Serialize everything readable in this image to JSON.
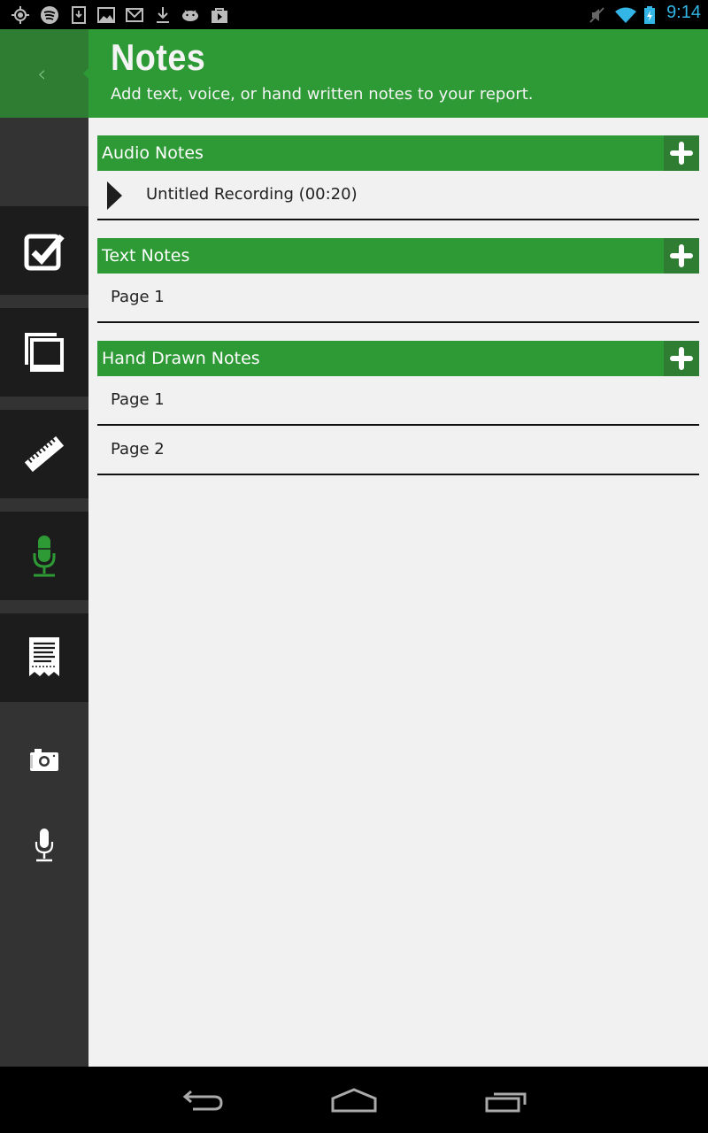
{
  "status_bar": {
    "left_icons": [
      "gps-icon",
      "spotify-icon",
      "sd-download-icon",
      "gallery-icon",
      "gmail-icon",
      "download-icon",
      "android-icon",
      "play-store-icon"
    ],
    "right_icons": [
      "mute-icon",
      "wifi-icon",
      "battery-charging-icon"
    ],
    "time": "9:14",
    "time_color": "#33b5e5"
  },
  "header": {
    "title": "Notes",
    "subtitle": "Add text, voice, or hand written notes to your report."
  },
  "sidebar": {
    "back_icon": "back-chevron-icon",
    "items": [
      {
        "name": "checklist",
        "icon": "checkbox-icon",
        "active": false
      },
      {
        "name": "photos",
        "icon": "photos-stack-icon",
        "active": false
      },
      {
        "name": "measurements",
        "icon": "ruler-icon",
        "active": false
      },
      {
        "name": "notes",
        "icon": "microphone-icon",
        "active": true
      },
      {
        "name": "receipts",
        "icon": "receipt-icon",
        "active": false
      }
    ],
    "quick_actions": [
      {
        "name": "camera",
        "icon": "camera-icon"
      },
      {
        "name": "record",
        "icon": "microphone-icon"
      }
    ]
  },
  "sections": [
    {
      "title": "Audio Notes",
      "add_label": "+",
      "items": [
        {
          "label": "Untitled Recording (00:20)",
          "type": "audio"
        }
      ]
    },
    {
      "title": "Text Notes",
      "add_label": "+",
      "items": [
        {
          "label": "Page 1",
          "type": "text"
        }
      ]
    },
    {
      "title": "Hand Drawn Notes",
      "add_label": "+",
      "items": [
        {
          "label": "Page 1",
          "type": "drawing"
        },
        {
          "label": "Page 2",
          "type": "drawing"
        }
      ]
    }
  ],
  "colors": {
    "accent": "#2d9a35",
    "accent_dark": "#2e7d32",
    "sidebar_bg": "#333333",
    "tile_bg": "#1c1c1c",
    "content_bg": "#f1f1f1"
  },
  "nav_bar": {
    "buttons": [
      "back-icon",
      "home-icon",
      "recent-apps-icon"
    ]
  }
}
